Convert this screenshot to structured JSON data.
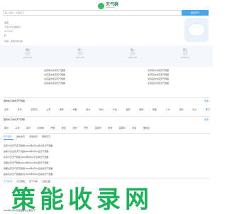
{
  "header": {
    "logo_title": "天气群",
    "logo_sub": "tianqiqun.com"
  },
  "search": {
    "placeholder": "输入城市、乡镇名字",
    "button": "搜索天气"
  },
  "current": {
    "line1": "北京",
    "line2": "今天22日(星期日)",
    "line3": "22℃/7℃",
    "line4": "晴",
    "line5": "风向：西南风转3级"
  },
  "forecast": [
    {
      "name": "周日",
      "temp": "22℃/7℃"
    },
    {
      "name": "周一",
      "temp": "22℃/7℃"
    },
    {
      "name": "周二",
      "temp": "22℃/7℃"
    },
    {
      "name": "周三",
      "temp": "22℃/7℃"
    }
  ],
  "link_rows": [
    [
      "北京来访北京天气预报",
      "北京来访北京天气预报"
    ],
    [
      "北京来访北京天气预报",
      "北京来访北京天气预报"
    ],
    [
      "北京来访北京天气预报",
      "北京来访北京天气预报"
    ],
    [
      "北京来访北京天气预报",
      "北京来访北京天气预报"
    ]
  ],
  "hot_cities": {
    "title": "国内热门城市天气预报",
    "more": "更多",
    "cities": [
      "北京",
      "天津",
      "石家庄",
      "上海",
      "重庆",
      "成都",
      "贵州",
      "杭州",
      "宁波",
      "合肥",
      "福建",
      "南昌",
      "广州",
      "深圳",
      "长沙",
      "厦门"
    ]
  },
  "intl_cities": {
    "title": "国际热门城市天气预报",
    "more": "更多",
    "cities": [
      "首尔",
      "东京",
      "首尔",
      "新加坡",
      "巴黎",
      "悉尼",
      "纽约",
      "开罗",
      "温哥华",
      "伦敦",
      "莫斯科",
      "曼谷",
      "雅加达"
    ]
  },
  "news": {
    "tabs": [
      "天气资讯",
      "最新资讯",
      "双语资讯",
      "假期天气"
    ],
    "items": [
      "北京今日天气实况观测 2024年6月22日北京天气预报",
      "最新今日北京天气  最新2024年6月22日天气预报",
      "北京今日天气预报 2024年6月22日北京天气预报",
      "近期北京天气预报 2024年6月22日北京天气预报",
      "现都北京天气实况观测 2024年6月22日最新天气预报",
      "最新北京天气预报实况 2024年6月22日最新天气预报"
    ]
  },
  "bottom_tabs": [
    "大气状况",
    "今日预报",
    "空气污染",
    "卫星云图"
  ],
  "bottom_line": "2024年6月22日我国各省主要天气",
  "watermark": "策能收录网"
}
